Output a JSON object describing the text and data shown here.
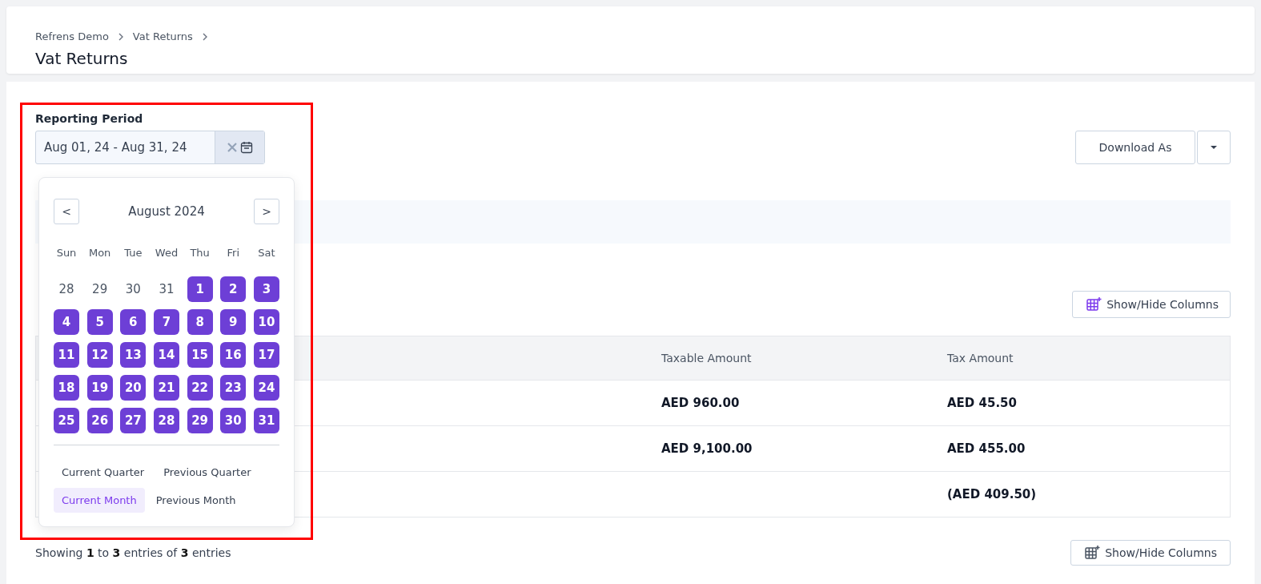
{
  "breadcrumbs": [
    "Refrens Demo",
    "Vat Returns"
  ],
  "page_title": "Vat Returns",
  "reporting_period": {
    "label": "Reporting Period",
    "value": "Aug 01, 24 - Aug 31, 24"
  },
  "download": {
    "label": "Download As"
  },
  "calendar": {
    "month": "August 2024",
    "prev": "<",
    "next": ">",
    "weekdays": [
      "Sun",
      "Mon",
      "Tue",
      "Wed",
      "Thu",
      "Fri",
      "Sat"
    ],
    "weeks": [
      [
        {
          "label": "28",
          "selected": false
        },
        {
          "label": "29",
          "selected": false
        },
        {
          "label": "30",
          "selected": false
        },
        {
          "label": "31",
          "selected": false
        },
        {
          "label": "1",
          "selected": true
        },
        {
          "label": "2",
          "selected": true
        },
        {
          "label": "3",
          "selected": true
        }
      ],
      [
        {
          "label": "4",
          "selected": true
        },
        {
          "label": "5",
          "selected": true
        },
        {
          "label": "6",
          "selected": true
        },
        {
          "label": "7",
          "selected": true
        },
        {
          "label": "8",
          "selected": true
        },
        {
          "label": "9",
          "selected": true
        },
        {
          "label": "10",
          "selected": true
        }
      ],
      [
        {
          "label": "11",
          "selected": true
        },
        {
          "label": "12",
          "selected": true
        },
        {
          "label": "13",
          "selected": true
        },
        {
          "label": "14",
          "selected": true
        },
        {
          "label": "15",
          "selected": true
        },
        {
          "label": "16",
          "selected": true
        },
        {
          "label": "17",
          "selected": true
        }
      ],
      [
        {
          "label": "18",
          "selected": true
        },
        {
          "label": "19",
          "selected": true
        },
        {
          "label": "20",
          "selected": true
        },
        {
          "label": "21",
          "selected": true
        },
        {
          "label": "22",
          "selected": true
        },
        {
          "label": "23",
          "selected": true
        },
        {
          "label": "24",
          "selected": true
        }
      ],
      [
        {
          "label": "25",
          "selected": true
        },
        {
          "label": "26",
          "selected": true
        },
        {
          "label": "27",
          "selected": true
        },
        {
          "label": "28",
          "selected": true
        },
        {
          "label": "29",
          "selected": true
        },
        {
          "label": "30",
          "selected": true
        },
        {
          "label": "31",
          "selected": true
        }
      ]
    ],
    "presets": [
      [
        {
          "label": "Current Quarter",
          "selected": false
        },
        {
          "label": "Previous Quarter",
          "selected": false
        }
      ],
      [
        {
          "label": "Current Month",
          "selected": true
        },
        {
          "label": "Previous Month",
          "selected": false
        }
      ]
    ]
  },
  "show_hide_top": {
    "label": "Show/Hide Columns"
  },
  "table": {
    "columns": [
      "Taxable Amount",
      "Tax Amount"
    ],
    "rows": [
      [
        "AED 960.00",
        "AED 45.50"
      ],
      [
        "AED 9,100.00",
        "AED 455.00"
      ],
      [
        "",
        "(AED 409.50)"
      ]
    ]
  },
  "footer": {
    "text": "Showing **1** to **3** entries of **3** entries"
  },
  "show_hide_bottom": {
    "label": "Show/Hide Columns"
  }
}
